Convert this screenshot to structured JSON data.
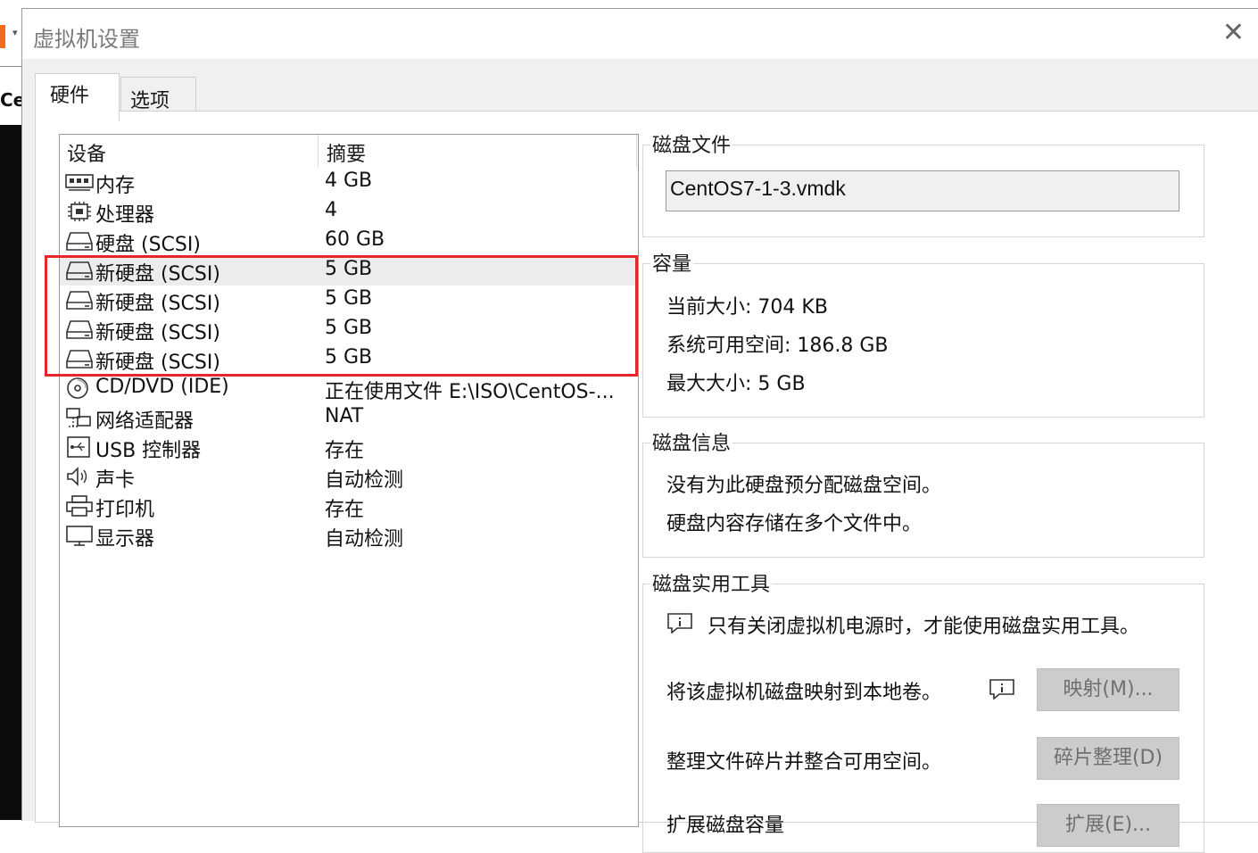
{
  "window": {
    "title": "虚拟机设置",
    "close_glyph": "✕"
  },
  "background": {
    "partial_text": "Cer"
  },
  "tabs": [
    {
      "label": "硬件",
      "active": true
    },
    {
      "label": "选项",
      "active": false
    }
  ],
  "device_list": {
    "headers": [
      "设备",
      "摘要"
    ],
    "rows": [
      {
        "icon": "memory-icon",
        "name": "内存",
        "summary": "4 GB"
      },
      {
        "icon": "processor-icon",
        "name": "处理器",
        "summary": "4"
      },
      {
        "icon": "harddisk-icon",
        "name": "硬盘 (SCSI)",
        "summary": "60 GB"
      },
      {
        "icon": "harddisk-icon",
        "name": "新硬盘 (SCSI)",
        "summary": "5 GB",
        "selected": true
      },
      {
        "icon": "harddisk-icon",
        "name": "新硬盘 (SCSI)",
        "summary": "5 GB"
      },
      {
        "icon": "harddisk-icon",
        "name": "新硬盘 (SCSI)",
        "summary": "5 GB"
      },
      {
        "icon": "harddisk-icon",
        "name": "新硬盘 (SCSI)",
        "summary": "5 GB"
      },
      {
        "icon": "cd-dvd-icon",
        "name": "CD/DVD (IDE)",
        "summary": "正在使用文件 E:\\ISO\\CentOS-..."
      },
      {
        "icon": "network-adapter-icon",
        "name": "网络适配器",
        "summary": "NAT"
      },
      {
        "icon": "usb-controller-icon",
        "name": "USB 控制器",
        "summary": "存在"
      },
      {
        "icon": "sound-card-icon",
        "name": "声卡",
        "summary": "自动检测"
      },
      {
        "icon": "printer-icon",
        "name": "打印机",
        "summary": "存在"
      },
      {
        "icon": "display-icon",
        "name": "显示器",
        "summary": "自动检测"
      }
    ]
  },
  "disk_file": {
    "title": "磁盘文件",
    "value": "CentOS7-1-3.vmdk"
  },
  "capacity": {
    "title": "容量",
    "current_size": "当前大小: 704 KB",
    "available": "系统可用空间: 186.8 GB",
    "max_size": "最大大小: 5 GB"
  },
  "disk_info": {
    "title": "磁盘信息",
    "line1": "没有为此硬盘预分配磁盘空间。",
    "line2": "硬盘内容存储在多个文件中。"
  },
  "disk_tools": {
    "title": "磁盘实用工具",
    "notice": "只有关闭虚拟机电源时，才能使用磁盘实用工具。",
    "map_text": "将该虚拟机磁盘映射到本地卷。",
    "map_button": "映射(M)...",
    "defrag_text": "整理文件碎片并整合可用空间。",
    "defrag_button": "碎片整理(D)",
    "expand_text": "扩展磁盘容量",
    "expand_button": "扩展(E)..."
  },
  "colors": {
    "highlight_box": "#e8252a",
    "accent_orange": "#f26b1d"
  }
}
